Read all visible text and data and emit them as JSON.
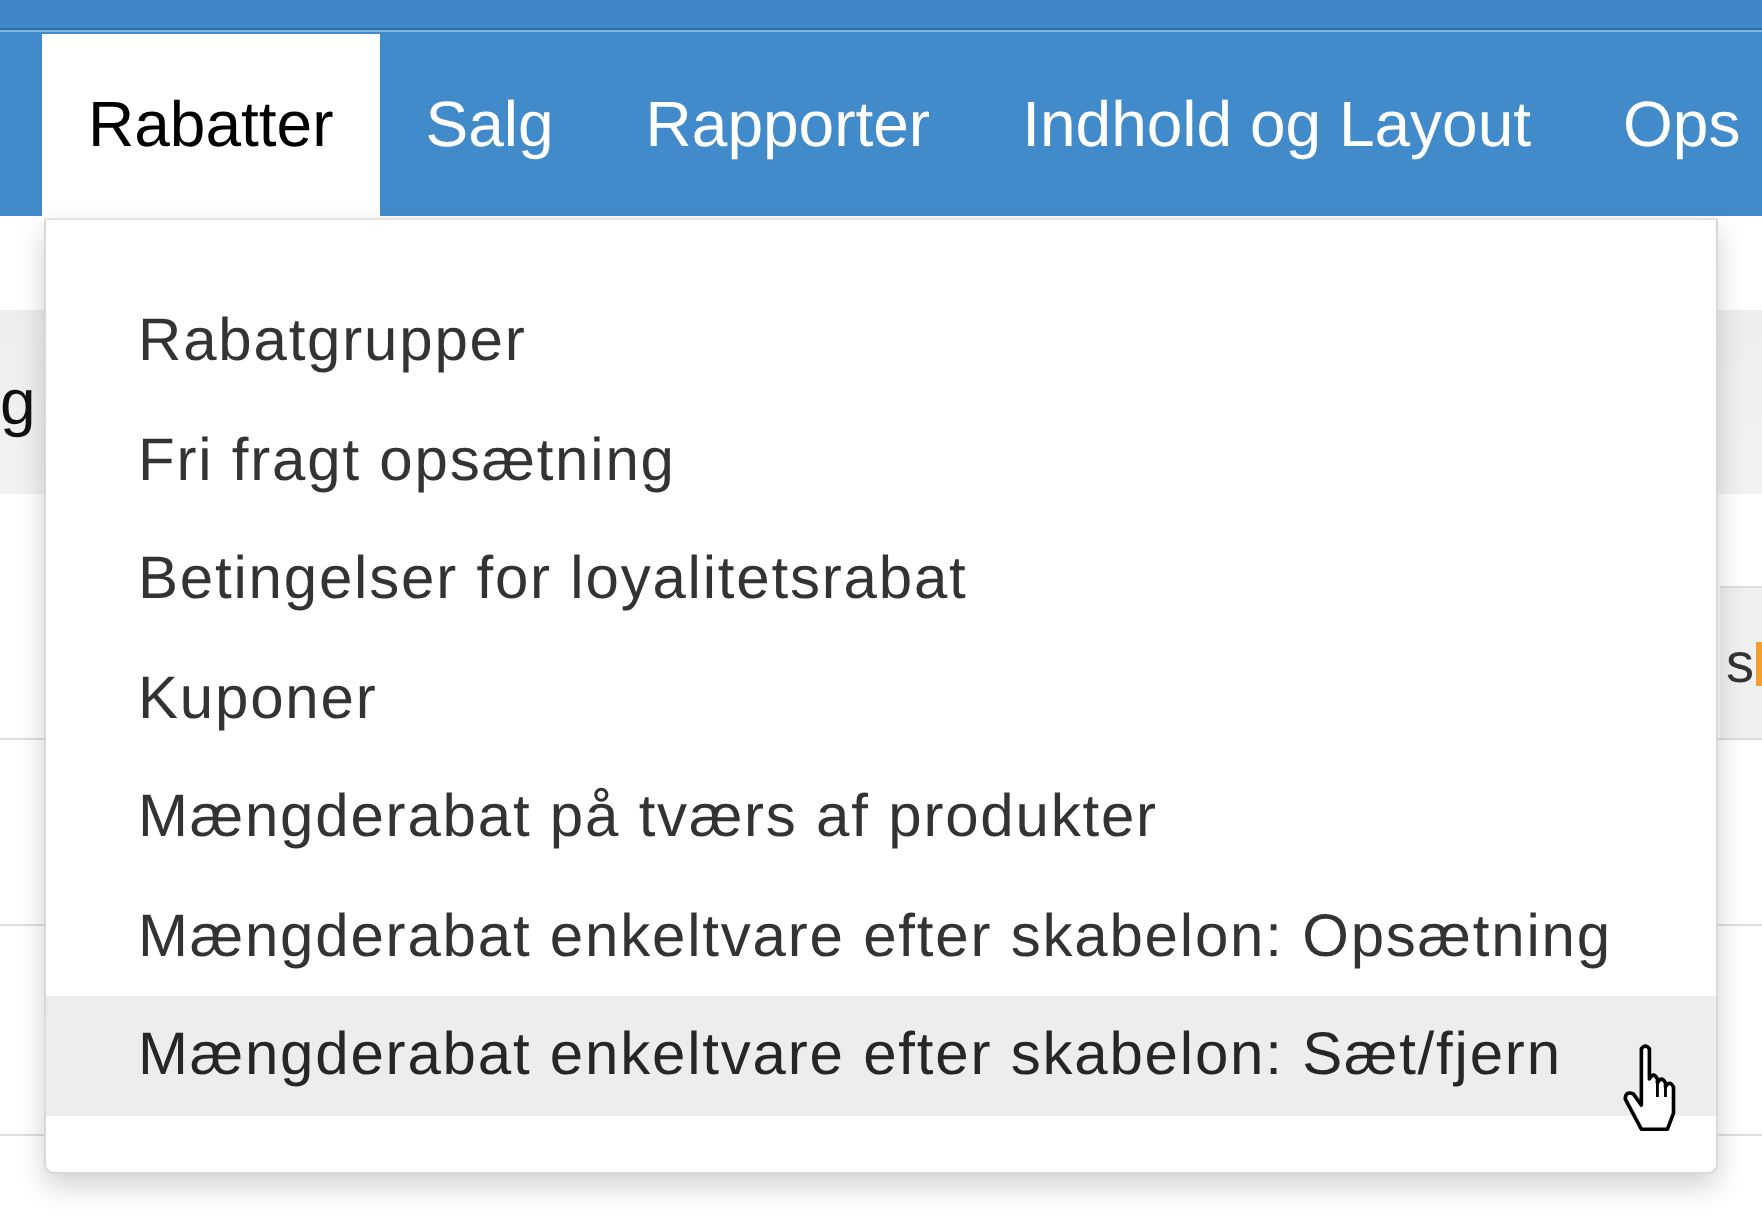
{
  "nav": {
    "tabs": [
      {
        "label": "Rabatter",
        "selected": true
      },
      {
        "label": "Salg",
        "selected": false
      },
      {
        "label": "Rapporter",
        "selected": false
      },
      {
        "label": "Indhold og Layout",
        "selected": false
      },
      {
        "label": "Ops",
        "selected": false
      }
    ]
  },
  "dropdown": {
    "items": [
      {
        "label": "Rabatgrupper",
        "hovered": false
      },
      {
        "label": "Fri fragt opsætning",
        "hovered": false
      },
      {
        "label": "Betingelser for loyalitetsrabat",
        "hovered": false
      },
      {
        "label": "Kuponer",
        "hovered": false
      },
      {
        "label": "Mængderabat på tværs af produkter",
        "hovered": false
      },
      {
        "label": "Mængderabat enkeltvare efter skabelon: Opsætning",
        "hovered": false
      },
      {
        "label": "Mængderabat enkeltvare efter skabelon: Sæt/fjern",
        "hovered": true
      }
    ]
  },
  "page": {
    "heading": "g",
    "column_header": "s"
  }
}
